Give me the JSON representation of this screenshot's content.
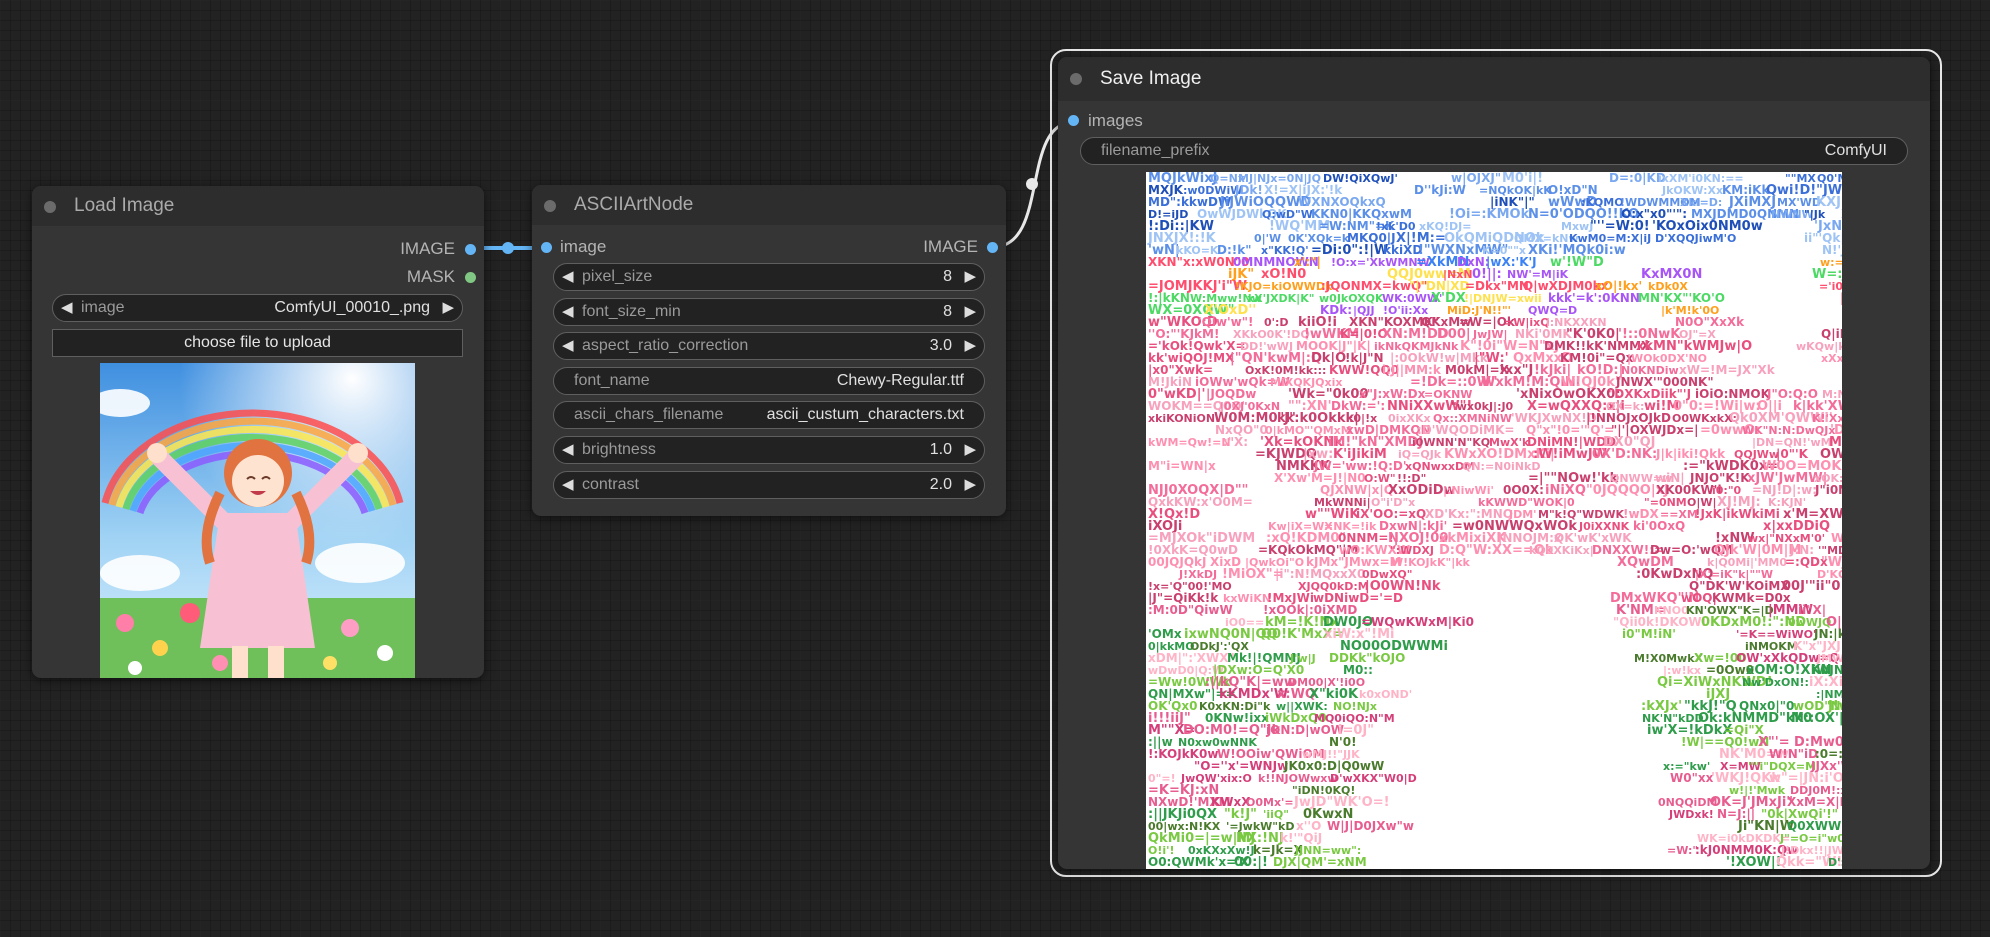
{
  "colors": {
    "canvas_bg": "#222222",
    "node_bg": "#353535",
    "title_bg": "#2d2d2d",
    "image_link": "#64b5f6",
    "mask_slot": "#81c784",
    "selected_outline": "#e8e8e8"
  },
  "load_image": {
    "title": "Load Image",
    "outputs": {
      "image": "IMAGE",
      "mask": "MASK"
    },
    "image_widget": {
      "name": "image",
      "value": "ComfyUI_00010_.png"
    },
    "upload_label": "choose file to upload",
    "preview_icon": "anime-girl-rainbow-thumbnail"
  },
  "ascii_node": {
    "title": "ASCIIArtNode",
    "input": "image",
    "output": "IMAGE",
    "widgets": {
      "pixel_size": {
        "name": "pixel_size",
        "value": "8"
      },
      "font_size_min": {
        "name": "font_size_min",
        "value": "8"
      },
      "aspect_ratio_correction": {
        "name": "aspect_ratio_correction",
        "value": "3.0"
      },
      "font_name": {
        "name": "font_name",
        "value": "Chewy-Regular.ttf"
      },
      "ascii_chars_filename": {
        "name": "ascii_chars_filename",
        "value": "ascii_custum_characters.txt"
      },
      "brightness": {
        "name": "brightness",
        "value": "1.0"
      },
      "contrast": {
        "name": "contrast",
        "value": "2.0"
      }
    }
  },
  "save_image": {
    "title": "Save Image",
    "input": "images",
    "filename_prefix": {
      "name": "filename_prefix",
      "value": "ComfyUI"
    },
    "preview_icon": "ascii-art-output-image"
  }
}
